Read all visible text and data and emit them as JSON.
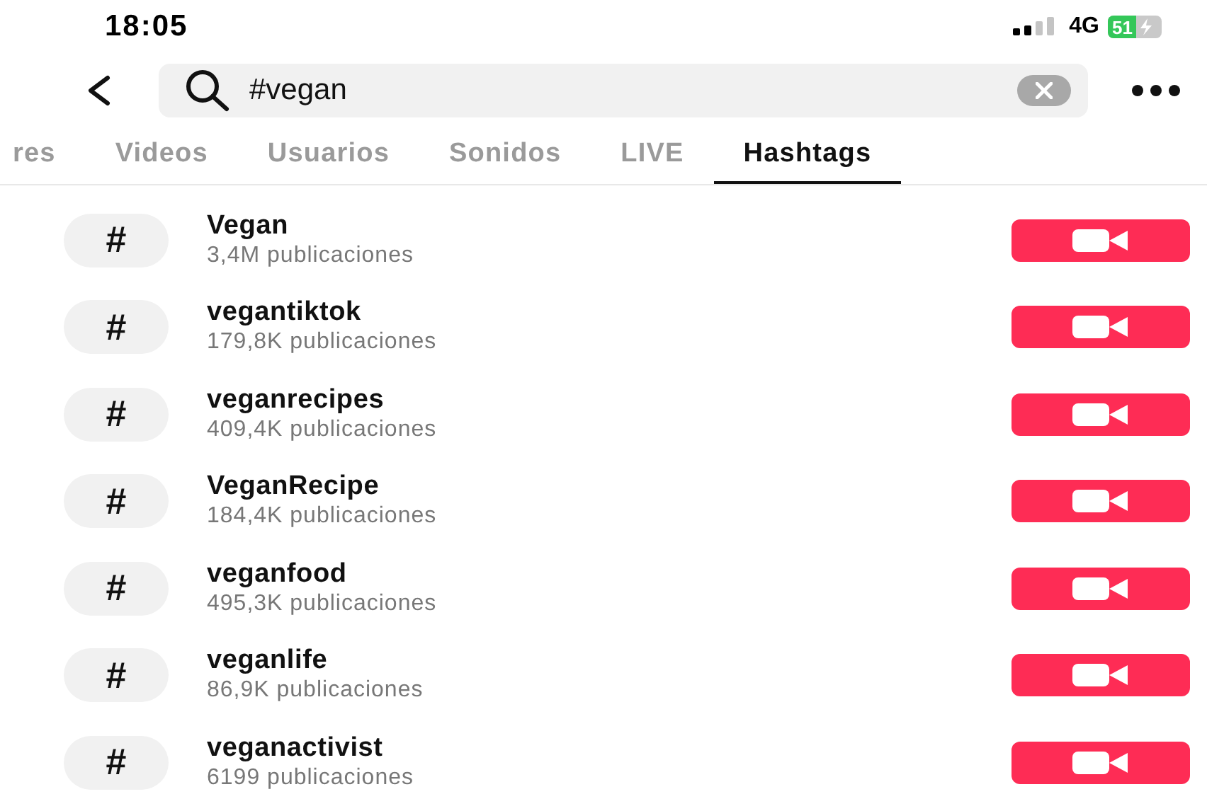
{
  "status_bar": {
    "time": "18:05",
    "network": "4G",
    "battery": "51"
  },
  "search": {
    "value": "#vegan"
  },
  "tabs": [
    {
      "label": "res",
      "selected": false
    },
    {
      "label": "Videos",
      "selected": false
    },
    {
      "label": "Usuarios",
      "selected": false
    },
    {
      "label": "Sonidos",
      "selected": false
    },
    {
      "label": "LIVE",
      "selected": false
    },
    {
      "label": "Hashtags",
      "selected": true
    }
  ],
  "hashtags": [
    {
      "icon": "#",
      "name": "Vegan",
      "count": "3,4M publicaciones"
    },
    {
      "icon": "#",
      "name": "vegantiktok",
      "count": "179,8K publicaciones"
    },
    {
      "icon": "#",
      "name": "veganrecipes",
      "count": "409,4K publicaciones"
    },
    {
      "icon": "#",
      "name": "VeganRecipe",
      "count": "184,4K publicaciones"
    },
    {
      "icon": "#",
      "name": "veganfood",
      "count": "495,3K publicaciones"
    },
    {
      "icon": "#",
      "name": "veganlife",
      "count": "86,9K publicaciones"
    },
    {
      "icon": "#",
      "name": "veganactivist",
      "count": "6199 publicaciones"
    }
  ]
}
